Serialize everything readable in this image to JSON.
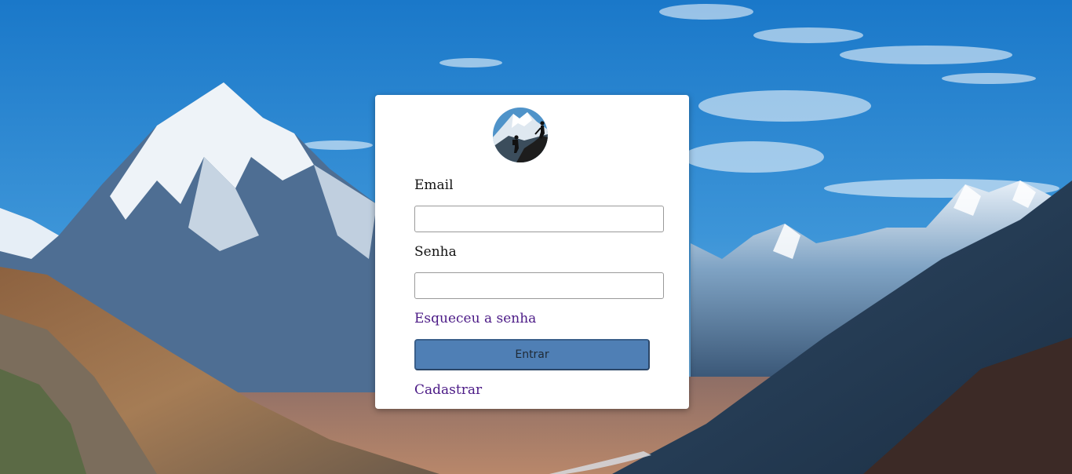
{
  "form": {
    "email_label": "Email",
    "password_label": "Senha",
    "email_value": "",
    "password_value": "",
    "forgot_link": "Esqueceu a senha",
    "submit_label": "Entrar",
    "register_link": "Cadastrar"
  },
  "colors": {
    "link": "#4b1a86",
    "button": "#4f7fb5",
    "card": "#ffffff"
  },
  "icons": {
    "avatar": "mountain-climbers-avatar"
  }
}
